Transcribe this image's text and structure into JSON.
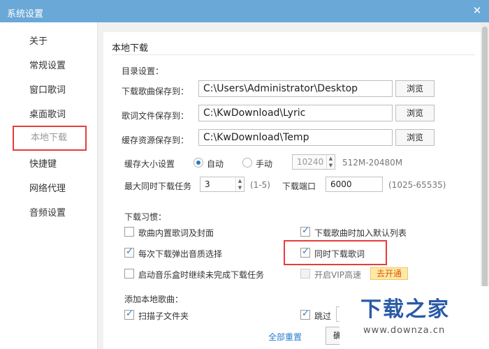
{
  "window": {
    "title": "系统设置",
    "close_glyph": "✕"
  },
  "sidebar": {
    "items": [
      {
        "label": "关于"
      },
      {
        "label": "常规设置"
      },
      {
        "label": "窗口歌词"
      },
      {
        "label": "桌面歌词"
      },
      {
        "label": "本地下载",
        "active": true
      },
      {
        "label": "快捷键"
      },
      {
        "label": "网络代理"
      },
      {
        "label": "音频设置"
      }
    ]
  },
  "section": {
    "title": "本地下载"
  },
  "directory": {
    "heading": "目录设置：",
    "rows": [
      {
        "label": "下载歌曲保存到：",
        "value": "C:\\Users\\Administrator\\Desktop",
        "browse": "浏览"
      },
      {
        "label": "歌词文件保存到：",
        "value": "C:\\KwDownload\\Lyric",
        "browse": "浏览"
      },
      {
        "label": "缓存资源保存到：",
        "value": "C:\\KwDownload\\Temp",
        "browse": "浏览"
      }
    ]
  },
  "cache": {
    "label": "缓存大小设置",
    "auto": "自动",
    "manual": "手动",
    "size_value": "10240",
    "range": "512M-20480M",
    "selected": "auto"
  },
  "concurrency": {
    "label": "最大同时下载任务",
    "value": "3",
    "range": "(1-5)",
    "port_label": "下载端口",
    "port_value": "6000",
    "port_range": "(1025-65535)"
  },
  "habits": {
    "heading": "下载习惯：",
    "options": [
      {
        "label": "歌曲内置歌词及封面",
        "checked": false
      },
      {
        "label": "下载歌曲时加入默认列表",
        "checked": true
      },
      {
        "label": "每次下载弹出音质选择",
        "checked": true
      },
      {
        "label": "同时下载歌词",
        "checked": true
      },
      {
        "label": "启动音乐盒时继续未完成下载任务",
        "checked": false
      },
      {
        "label": "开启VIP高速",
        "checked": false,
        "disabled": true
      }
    ],
    "vip_button": "去开通"
  },
  "add_local": {
    "heading": "添加本地歌曲：",
    "scan_label": "扫描子文件夹",
    "scan_checked": true,
    "skip_label": "跳过",
    "skip_checked": true
  },
  "footer": {
    "reset": "全部重置",
    "confirm": "确"
  },
  "watermark": {
    "text": "下载之家",
    "url": "www.downza.cn"
  },
  "colors": {
    "titlebar": "#6aa8d8",
    "accent": "#2b78c5",
    "highlight": "#e83b3b",
    "watermark": "#2b5aa8"
  }
}
